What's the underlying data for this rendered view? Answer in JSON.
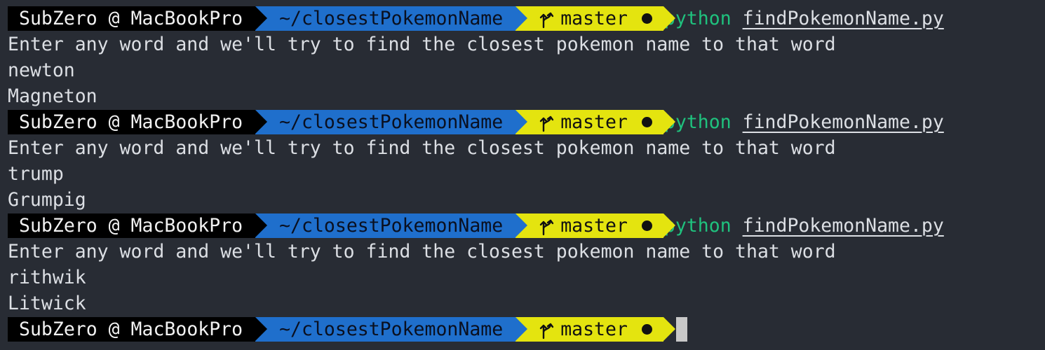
{
  "prompt": {
    "user_host": "SubZero @ MacBookPro",
    "directory": "~/closestPokemonName",
    "branch": "master",
    "branch_icon": "git-branch-icon",
    "dirty_indicator": "●"
  },
  "colors": {
    "background": "#282c34",
    "user_segment": "#000000",
    "dir_segment": "#1f6fcc",
    "git_segment": "#e4e40f",
    "command_program": "#1fc27e",
    "text": "#dcdfe4"
  },
  "command": {
    "program": "python",
    "argument": "findPokemonName.py"
  },
  "sessions": [
    {
      "prompt_text": "Enter any word and we'll try to find the closest pokemon name to that word",
      "input": "newton",
      "output": "Magneton"
    },
    {
      "prompt_text": "Enter any word and we'll try to find the closest pokemon name to that word",
      "input": "trump",
      "output": "Grumpig"
    },
    {
      "prompt_text": "Enter any word and we'll try to find the closest pokemon name to that word",
      "input": "rithwik",
      "output": "Litwick"
    }
  ]
}
